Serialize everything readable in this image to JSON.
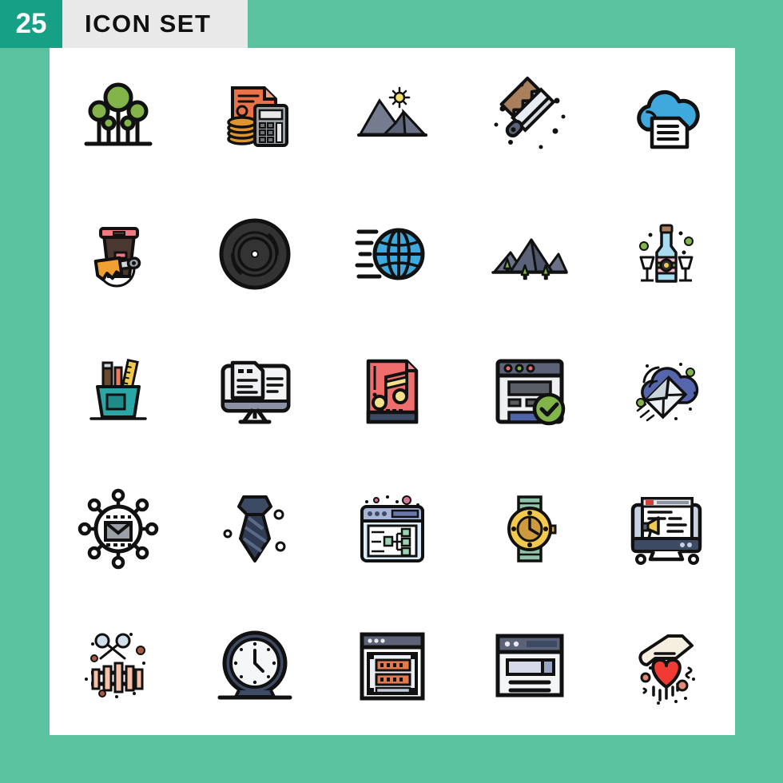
{
  "header": {
    "count": "25",
    "title": "ICON SET"
  },
  "colors": {
    "page_background": "#5bc2a0",
    "badge_background": "#16a085",
    "title_background": "#e9e9e9",
    "card_background": "#ffffff",
    "outline": "#111111",
    "green": "#7fb241",
    "orange": "#e8734a",
    "blue": "#3fa9dd",
    "slate": "#5c6378",
    "red": "#ef6d6d",
    "teal": "#2ba6a6",
    "yellow": "#f2c94c",
    "pink": "#f3b8cc",
    "brown": "#a9805c"
  },
  "grid": {
    "columns": 5,
    "rows": 5,
    "total": 25
  },
  "icons": [
    {
      "id": "trees-growth-icon",
      "label": "Trees",
      "row": 1,
      "col": 1
    },
    {
      "id": "accounting-icon",
      "label": "Accounting",
      "row": 1,
      "col": 2
    },
    {
      "id": "mountain-sun-icon",
      "label": "Mountain",
      "row": 1,
      "col": 3
    },
    {
      "id": "paint-brush-icon",
      "label": "Paint Brush",
      "row": 1,
      "col": 4
    },
    {
      "id": "cloud-document-icon",
      "label": "Cloud Document",
      "row": 1,
      "col": 5
    },
    {
      "id": "paint-bucket-icon",
      "label": "Paint Bucket",
      "row": 2,
      "col": 1
    },
    {
      "id": "vinyl-record-icon",
      "label": "Vinyl Record",
      "row": 2,
      "col": 2
    },
    {
      "id": "globe-speed-icon",
      "label": "Global Speed",
      "row": 2,
      "col": 3
    },
    {
      "id": "mountains-trees-icon",
      "label": "Mountains",
      "row": 2,
      "col": 4
    },
    {
      "id": "wine-bottle-glasses-icon",
      "label": "Wine",
      "row": 2,
      "col": 5
    },
    {
      "id": "pencil-holder-icon",
      "label": "Stationery",
      "row": 3,
      "col": 1
    },
    {
      "id": "monitor-document-icon",
      "label": "Monitor Document",
      "row": 3,
      "col": 2
    },
    {
      "id": "music-file-icon",
      "label": "Music File",
      "row": 3,
      "col": 3
    },
    {
      "id": "browser-verified-icon",
      "label": "Verified Page",
      "row": 3,
      "col": 4
    },
    {
      "id": "cloud-mail-icon",
      "label": "Cloud Mail",
      "row": 3,
      "col": 5
    },
    {
      "id": "email-network-icon",
      "label": "Email Network",
      "row": 4,
      "col": 1
    },
    {
      "id": "necktie-icon",
      "label": "Necktie",
      "row": 4,
      "col": 2
    },
    {
      "id": "browser-sitemap-icon",
      "label": "Sitemap",
      "row": 4,
      "col": 3
    },
    {
      "id": "wristwatch-icon",
      "label": "Wristwatch",
      "row": 4,
      "col": 4
    },
    {
      "id": "monitor-megaphone-icon",
      "label": "Marketing",
      "row": 4,
      "col": 5
    },
    {
      "id": "xylophone-icon",
      "label": "Xylophone",
      "row": 5,
      "col": 1
    },
    {
      "id": "table-clock-icon",
      "label": "Clock",
      "row": 5,
      "col": 2
    },
    {
      "id": "browser-server-icon",
      "label": "Hosting",
      "row": 5,
      "col": 3
    },
    {
      "id": "browser-search-icon",
      "label": "Search Page",
      "row": 5,
      "col": 4
    },
    {
      "id": "hand-heart-icon",
      "label": "Charity",
      "row": 5,
      "col": 5
    }
  ]
}
